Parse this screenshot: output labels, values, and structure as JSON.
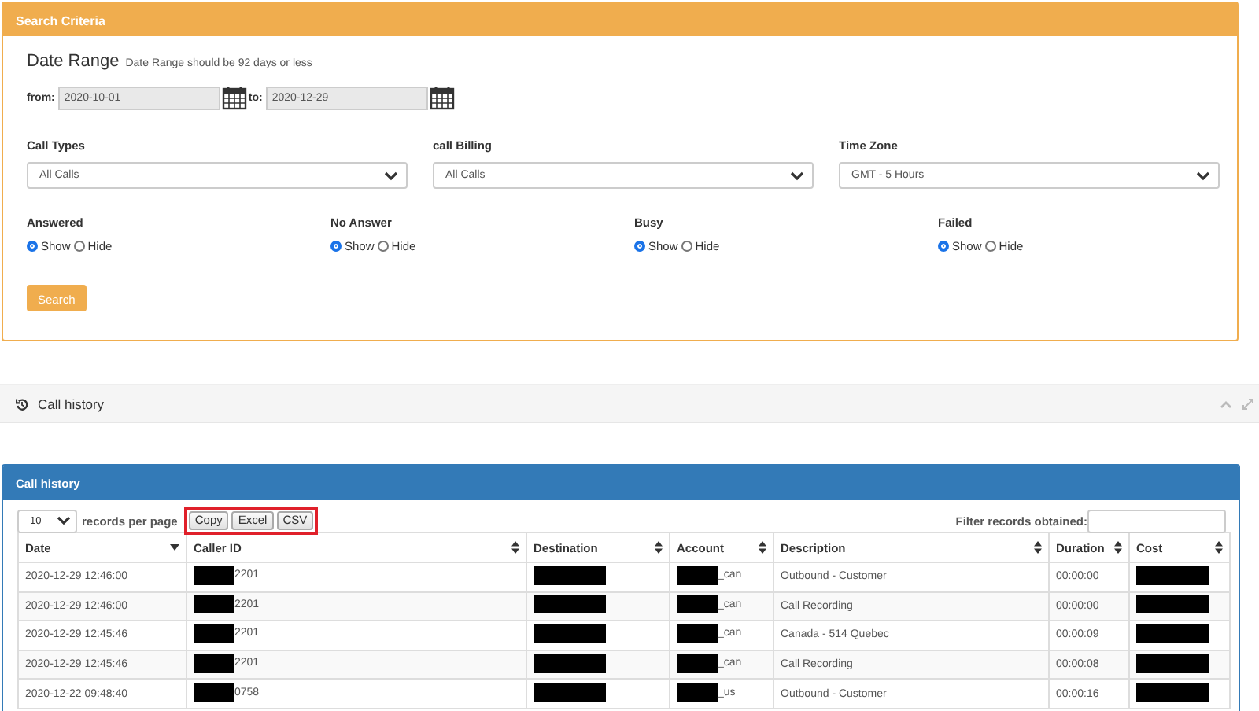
{
  "search_criteria": {
    "title": "Search Criteria",
    "date_range": {
      "label": "Date Range",
      "hint": "Date Range should be 92 days or less",
      "from_label": "from:",
      "from": "2020-10-01",
      "to_label": "to:",
      "to": "2020-12-29"
    },
    "selects": [
      {
        "label": "Call Types",
        "value": "All Calls"
      },
      {
        "label": "call Billing",
        "value": "All Calls"
      },
      {
        "label": "Time Zone",
        "value": "GMT - 5 Hours"
      }
    ],
    "filters": [
      {
        "label": "Answered",
        "options": [
          {
            "label": "Show",
            "selected": true
          },
          {
            "label": "Hide",
            "selected": false
          }
        ]
      },
      {
        "label": "No Answer",
        "options": [
          {
            "label": "Show",
            "selected": true
          },
          {
            "label": "Hide",
            "selected": false
          }
        ]
      },
      {
        "label": "Busy",
        "options": [
          {
            "label": "Show",
            "selected": true
          },
          {
            "label": "Hide",
            "selected": false
          }
        ]
      },
      {
        "label": "Failed",
        "options": [
          {
            "label": "Show",
            "selected": true
          },
          {
            "label": "Hide",
            "selected": false
          }
        ]
      }
    ],
    "search_button": "Search"
  },
  "section_bar": {
    "title": "Call history"
  },
  "call_history": {
    "title": "Call history",
    "page_size": "10",
    "page_size_label": "records per page",
    "export_buttons": [
      "Copy",
      "Excel",
      "CSV"
    ],
    "filter_label": "Filter records obtained:",
    "columns": [
      {
        "label": "Date",
        "sorted": true
      },
      {
        "label": "Caller ID",
        "sorted": false
      },
      {
        "label": "Destination",
        "sorted": false
      },
      {
        "label": "Account",
        "sorted": false
      },
      {
        "label": "Description",
        "sorted": false
      },
      {
        "label": "Duration",
        "sorted": false
      },
      {
        "label": "Cost",
        "sorted": false
      }
    ],
    "rows": [
      [
        {
          "text": "2020-12-29 12:46:00"
        },
        {
          "text": "2201",
          "redacted": true
        },
        {
          "redacted": true
        },
        {
          "text": "_can",
          "redacted": true
        },
        {
          "text": "Outbound - Customer"
        },
        {
          "text": "00:00:00"
        },
        {
          "redacted": true
        }
      ],
      [
        {
          "text": "2020-12-29 12:46:00"
        },
        {
          "text": "2201",
          "redacted": true
        },
        {
          "redacted": true
        },
        {
          "text": "_can",
          "redacted": true
        },
        {
          "text": "Call Recording"
        },
        {
          "text": "00:00:00"
        },
        {
          "redacted": true
        }
      ],
      [
        {
          "text": "2020-12-29 12:45:46"
        },
        {
          "text": "2201",
          "redacted": true
        },
        {
          "redacted": true
        },
        {
          "text": "_can",
          "redacted": true
        },
        {
          "text": "Canada - 514 Quebec"
        },
        {
          "text": "00:00:09"
        },
        {
          "redacted": true
        }
      ],
      [
        {
          "text": "2020-12-29 12:45:46"
        },
        {
          "text": "2201",
          "redacted": true
        },
        {
          "redacted": true
        },
        {
          "text": "_can",
          "redacted": true
        },
        {
          "text": "Call Recording"
        },
        {
          "text": "00:00:08"
        },
        {
          "redacted": true
        }
      ],
      [
        {
          "text": "2020-12-22 09:48:40"
        },
        {
          "text": "0758",
          "redacted": true
        },
        {
          "redacted": true
        },
        {
          "text": "_us",
          "redacted": true
        },
        {
          "text": "Outbound - Customer"
        },
        {
          "text": "00:00:16"
        },
        {
          "redacted": true
        }
      ]
    ]
  }
}
